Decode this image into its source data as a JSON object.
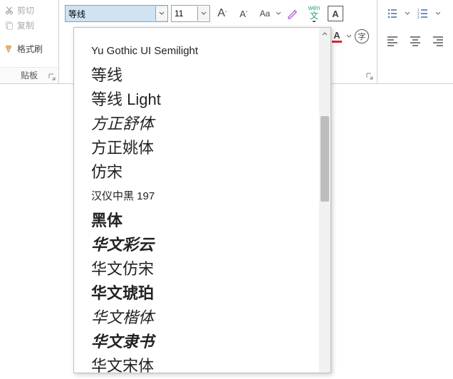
{
  "clipboard": {
    "cut": "剪切",
    "copy": "复制",
    "format_painter": "格式刷",
    "pane_title": "贴板"
  },
  "font": {
    "name_value": "等线",
    "size_value": "11",
    "wen_label_top": "wén",
    "wen_label_bottom": "文",
    "A_glyph": "A",
    "a_glyph": "a",
    "zi_glyph": "字"
  },
  "dropdown": {
    "items": [
      "Yu Gothic UI Semilight",
      "等线",
      "等线 Light",
      "方正舒体",
      "方正姚体",
      "仿宋",
      "汉仪中黑 197",
      "黑体",
      "华文彩云",
      "华文仿宋",
      "华文琥珀",
      "华文楷体",
      "华文隶书",
      "华文宋体"
    ]
  }
}
